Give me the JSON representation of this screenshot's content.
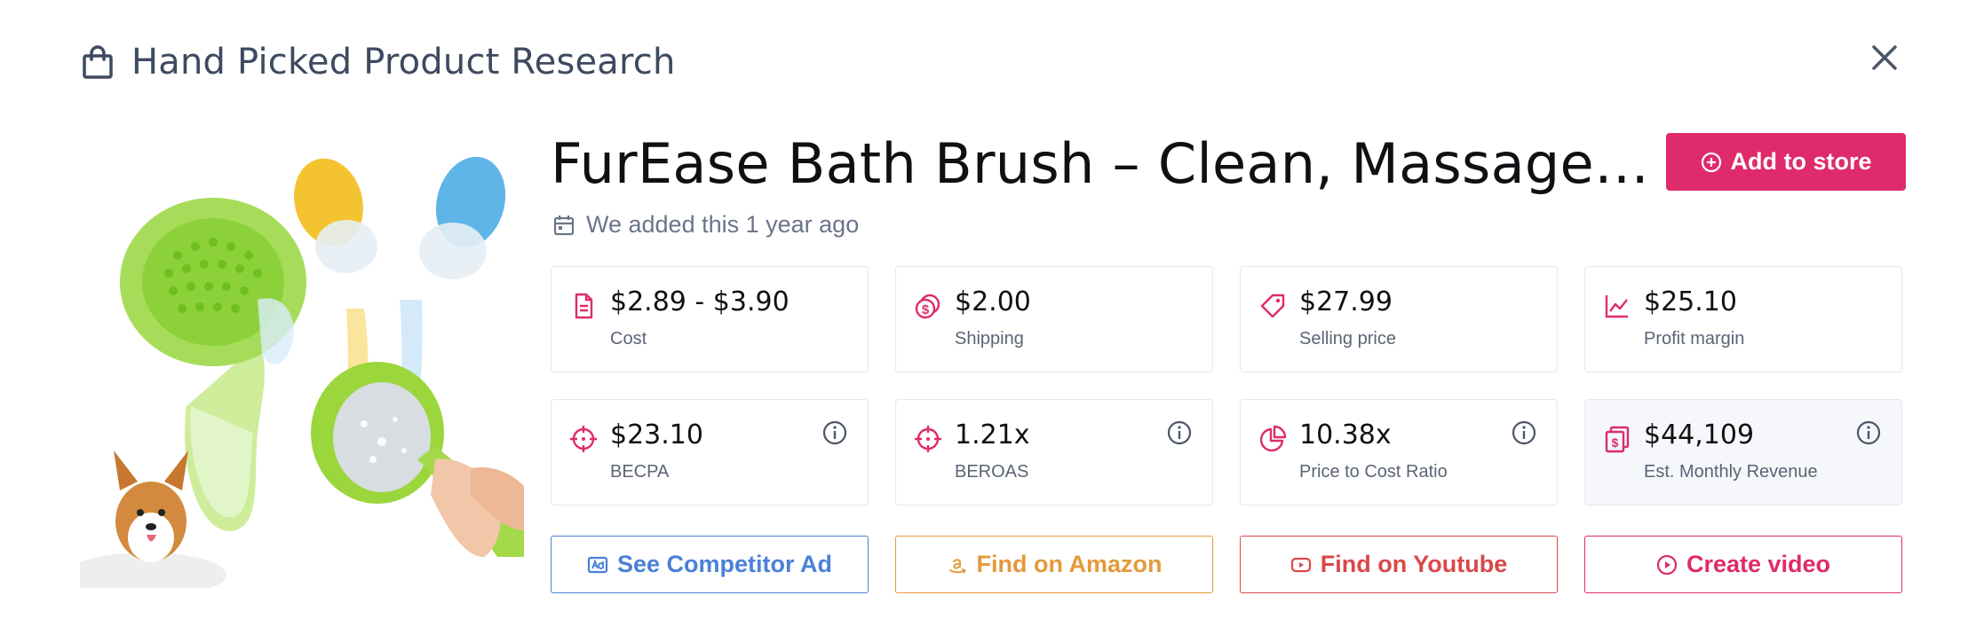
{
  "modal": {
    "title": "Hand Picked Product Research"
  },
  "product": {
    "title": "FurEase Bath Brush – Clean, Massage…",
    "added_text": "We added this 1 year ago",
    "add_button": "Add to store"
  },
  "metrics": [
    {
      "value": "$2.89 - $3.90",
      "label": "Cost",
      "icon": "document-icon"
    },
    {
      "value": "$2.00",
      "label": "Shipping",
      "icon": "coins-icon"
    },
    {
      "value": "$27.99",
      "label": "Selling price",
      "icon": "tag-icon"
    },
    {
      "value": "$25.10",
      "label": "Profit margin",
      "icon": "chart-line-icon"
    },
    {
      "value": "$23.10",
      "label": "BECPA",
      "icon": "crosshair-icon"
    },
    {
      "value": "1.21x",
      "label": "BEROAS",
      "icon": "crosshair-icon"
    },
    {
      "value": "10.38x",
      "label": "Price to Cost Ratio",
      "icon": "pie-chart-icon"
    },
    {
      "value": "$44,109",
      "label": "Est. Monthly Revenue",
      "icon": "money-icon"
    }
  ],
  "actions": {
    "competitor": "See Competitor Ad",
    "amazon": "Find on Amazon",
    "youtube": "Find on Youtube",
    "video": "Create video"
  },
  "colors": {
    "accent": "#df2b6b",
    "blue": "#4a80d8",
    "orange": "#e49a3c",
    "red": "#d94848",
    "pink": "#df2b6b",
    "heading": "#3d4a5f"
  }
}
